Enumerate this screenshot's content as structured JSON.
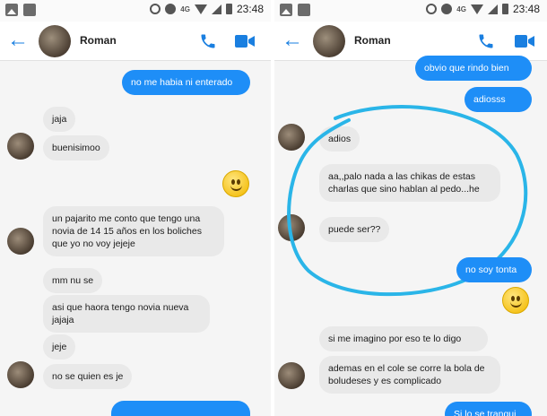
{
  "left": {
    "status": {
      "network": "4G",
      "time": "23:48"
    },
    "header": {
      "name": "Roman"
    },
    "messages": [
      "no me habia ni enterado",
      "jaja",
      "buenisimoo",
      "un pajarito me conto que tengo una novia  de 14 15 años en los boliches que yo no voy jejeje",
      "mm nu se",
      "asi que haora tengo novia nueva jajaja",
      "jeje",
      "no se quien es je"
    ]
  },
  "right": {
    "status": {
      "network": "4G",
      "time": "23:48"
    },
    "header": {
      "name": "Roman"
    },
    "messages": [
      "obvio que rindo bien",
      "adiosss",
      "adios",
      "aa,,palo nada a las chikas de estas charlas que sino hablan al pedo...he",
      "puede ser??",
      "no soy tonta",
      "si me imagino por eso te lo digo",
      "ademas en el cole se corre la bola de boludeses y es complicado",
      "Si lo se tranqui"
    ]
  },
  "colors": {
    "accent": "#1e8ef7",
    "incoming_bubble": "#e9e9e9",
    "annotation": "#2ab5e8"
  },
  "icons": [
    "back-arrow-icon",
    "phone-icon",
    "video-camera-icon",
    "smiley-emoji-icon"
  ]
}
